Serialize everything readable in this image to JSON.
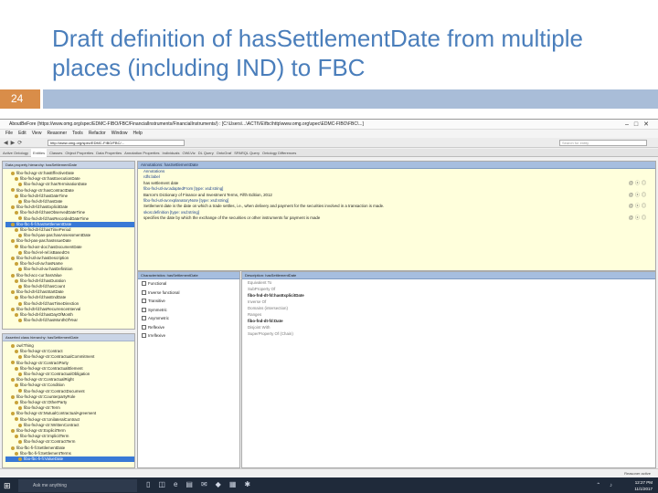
{
  "slide": {
    "title_line1": "Draft definition of hasSettlementDate from multiple",
    "title_line2": "places (including IND) to FBC",
    "page_number": "24"
  },
  "app": {
    "window_title": "AboutBeFore (https://www.omg.org/spec/EDMC-FIBO/FBC/FinancialInstruments/FinancialInstruments/) : [C:\\Users\\...\\ACTIVE\\fbc\\http\\www.omg.org\\spec\\EDMC-FIBO\\FBC\\...]",
    "menus": [
      "File",
      "Edit",
      "View",
      "Reasoner",
      "Tools",
      "Refactor",
      "Window",
      "Help"
    ],
    "address": "http://www.omg.org/spec/EDMC-FIBO/FBC/...",
    "search_placeholder": "Search for entity",
    "tabs": [
      "Active Ontology",
      "Entities",
      "Classes",
      "Object Properties",
      "Data Properties",
      "Annotation Properties",
      "Individuals",
      "OWLViz",
      "DL Query",
      "OntoGraf",
      "SPARQL Query",
      "Ontology Differences"
    ],
    "active_tab_index": 1
  },
  "top_tree": {
    "header": "Data property hierarchy: hasSettlementDate",
    "items": [
      "fibo-fnd-agr-ctr:hasEffectiveDate",
      "fibo-fnd-agr-ctr:hasExecutionDate",
      "fibo-fnd-agr-ctr:hasTerminationDate",
      "fibo-fnd-agr-ctr:hasContractDate",
      "fibo-fnd-dt-fd:hasDateTime",
      "fibo-fnd-dt-fd:hasDate",
      "fibo-fnd-dt-fd:hasExplicitDate",
      "fibo-fnd-dt-fd:hasObservedDateTime",
      "fibo-fnd-dt-fd:hasRecordedDateTime",
      "fibo-fbc-fi-fi:hasSettlementDate",
      "fibo-fnd-dt-fd:hasTimePeriod",
      "fibo-fnd-pas-pas:hasAssessmentDate",
      "fibo-fnd-pas-pas:hasIssueDate",
      "fibo-fnd-arr-doc:hasDocumentDate",
      "fibo-fnd-rel-rel:isBasedOn",
      "fibo-fnd-utl-av:hasDescription",
      "fibo-fnd-utl-av:hasName",
      "fibo-fnd-utl-av:hasDefinition",
      "fibo-fnd-acc-cur:hasValue",
      "fibo-fnd-dt-fd:hasDuration",
      "fibo-fnd-dt-fd:hasCount",
      "fibo-fnd-dt-fd:hasStartDate",
      "fibo-fnd-dt-fd:hasEndDate",
      "fibo-fnd-dt-fd:hasTimeDirection",
      "fibo-fnd-dt-fd:hasRecurrenceInterval",
      "fibo-fnd-dt-fd:hasDayOfMonth",
      "fibo-fnd-dt-fd:hasMonthOfYear"
    ],
    "selected_index": 9
  },
  "bottom_tree": {
    "header": "Asserted class hierarchy: hasSettlementDate",
    "items": [
      "owl:Thing",
      "fibo-fnd-agr-ctr:Contract",
      "fibo-fnd-agr-ctr:ContractualCommitment",
      "fibo-fnd-agr-ctr:ContractParty",
      "fibo-fnd-agr-ctr:ContractualElement",
      "fibo-fnd-agr-ctr:ContractualObligation",
      "fibo-fnd-agr-ctr:ContractualRight",
      "fibo-fnd-agr-ctr:Condition",
      "fibo-fnd-agr-ctr:ContractDocument",
      "fibo-fnd-agr-ctr:CounterpartyRole",
      "fibo-fnd-agr-ctr:OtherParty",
      "fibo-fnd-agr-ctr:Term",
      "fibo-fnd-agr-ctr:MutualContractualAgreement",
      "fibo-fnd-agr-ctr:UnilateralContract",
      "fibo-fnd-agr-ctr:WrittenContract",
      "fibo-fnd-agr-ctr:ExplicitTerm",
      "fibo-fnd-agr-ctr:ImplicitTerm",
      "fibo-fnd-agr-ctr:ContractTerm",
      "fibo-fbc-fi-fi:SettlementDate",
      "fibo-fbc-fi-fi:SettlementTerms",
      "fibo-fbc-fi-fi:ValueDate"
    ],
    "selected_index": 20
  },
  "annotations": {
    "header": "Annotations: hasSettlementDate",
    "rows": [
      {
        "text": "Annotations",
        "kind": "label"
      },
      {
        "text": "rdfs:label",
        "kind": "label"
      },
      {
        "text": "has settlement date",
        "kind": "value"
      },
      {
        "text": "fibo-fnd-utl-av:adaptedFrom  [type: xsd:string]",
        "kind": "label"
      },
      {
        "text": "Barron's Dictionary of Finance and Investment Terms, Fifth Edition, 2012",
        "kind": "value"
      },
      {
        "text": "fibo-fnd-utl-av:explanatoryNote  [type: xsd:string]",
        "kind": "label"
      },
      {
        "text": "Settlement date is the date on which a trade settles, i.e., when delivery and payment for the securities involved in a transaction is made.",
        "kind": "value"
      },
      {
        "text": "skos:definition  [type: xsd:string]",
        "kind": "label"
      },
      {
        "text": "specifies the date by which the exchange of the securities or other instruments for payment is made",
        "kind": "value"
      }
    ]
  },
  "characteristics": {
    "header": "Characteristics: hasSettlementDate",
    "items": [
      "Functional",
      "Inverse functional",
      "Transitive",
      "Symmetric",
      "Asymmetric",
      "Reflexive",
      "Irreflexive"
    ]
  },
  "description": {
    "header": "Description: hasSettlementDate",
    "rows": [
      {
        "text": "Equivalent To",
        "kind": "grey"
      },
      {
        "text": "SubProperty Of",
        "kind": "grey"
      },
      {
        "text": "fibo-fnd-dt-fd:hasExplicitDate",
        "kind": "bold"
      },
      {
        "text": "Inverse Of",
        "kind": "grey"
      },
      {
        "text": "Domains (intersection)",
        "kind": "grey"
      },
      {
        "text": "Ranges",
        "kind": "grey"
      },
      {
        "text": "fibo-fnd-dt-fd:Date",
        "kind": "bold"
      },
      {
        "text": "Disjoint With",
        "kind": "grey"
      },
      {
        "text": "SuperProperty Of (Chain)",
        "kind": "grey"
      }
    ]
  },
  "status": {
    "text": "Reasoner active"
  },
  "taskbar": {
    "search_placeholder": "Ask me anything",
    "time": "12:27 PM",
    "date": "11/1/2017"
  }
}
